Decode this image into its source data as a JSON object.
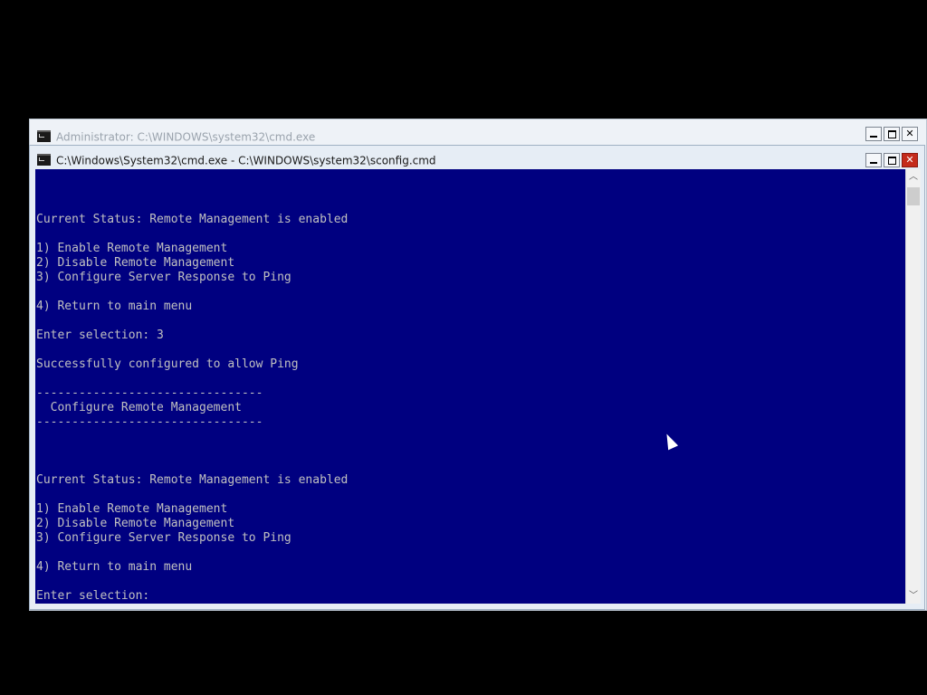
{
  "outer_window": {
    "title": "Administrator: C:\\WINDOWS\\system32\\cmd.exe",
    "icon": "cmd-icon"
  },
  "inner_window": {
    "title": "C:\\Windows\\System32\\cmd.exe - C:\\WINDOWS\\system32\\sconfig.cmd",
    "icon": "cmd-icon"
  },
  "controls": {
    "minimize": "minimize-icon",
    "maximize": "maximize-icon",
    "close": "✕"
  },
  "colors": {
    "console_background": "#000080",
    "console_text": "#c0c0c0",
    "close_button": "#c42b1c"
  },
  "console": {
    "lines": [
      "",
      "",
      "",
      "Current Status: Remote Management is enabled",
      "",
      "1) Enable Remote Management",
      "2) Disable Remote Management",
      "3) Configure Server Response to Ping",
      "",
      "4) Return to main menu",
      "",
      "Enter selection: 3",
      "",
      "Successfully configured to allow Ping",
      "",
      "--------------------------------",
      "  Configure Remote Management",
      "--------------------------------",
      "",
      "",
      "",
      "Current Status: Remote Management is enabled",
      "",
      "1) Enable Remote Management",
      "2) Disable Remote Management",
      "3) Configure Server Response to Ping",
      "",
      "4) Return to main menu",
      "",
      "Enter selection: "
    ]
  }
}
